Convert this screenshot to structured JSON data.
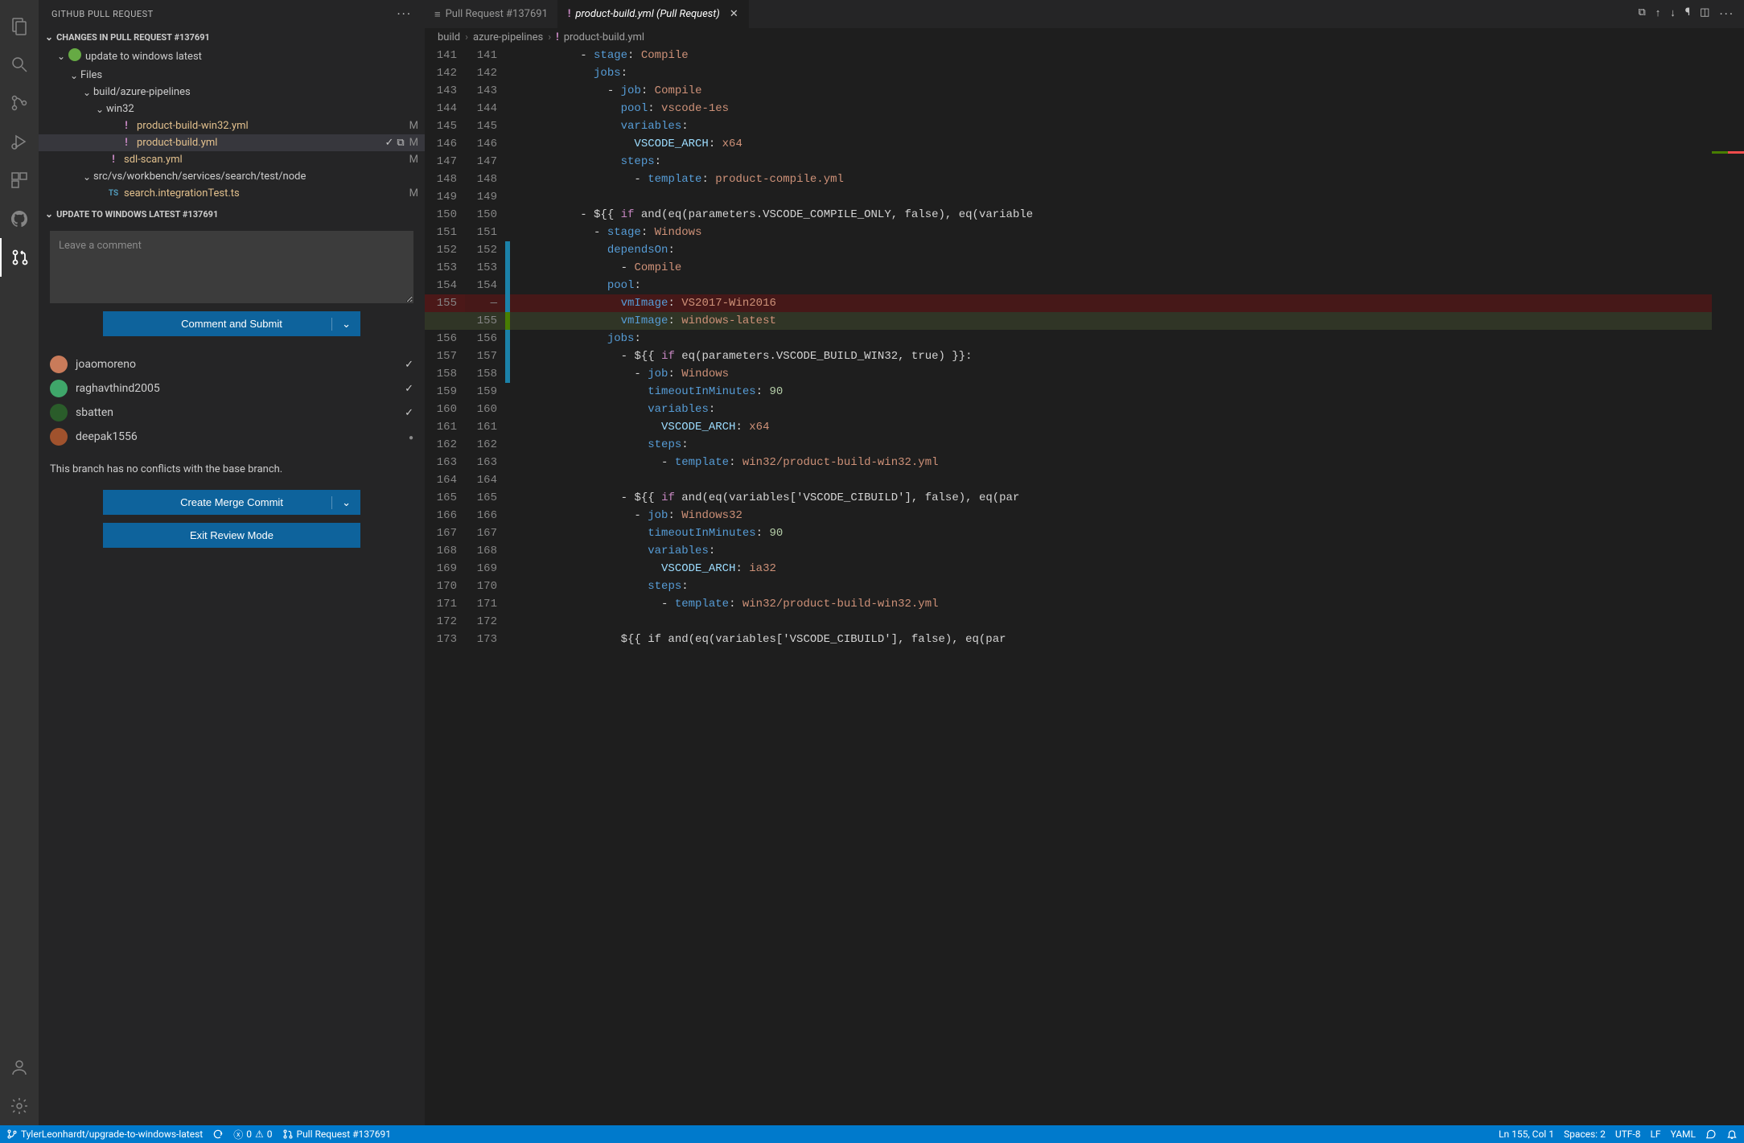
{
  "sidebar": {
    "title": "GITHUB PULL REQUEST",
    "section_changes": "CHANGES IN PULL REQUEST #137691",
    "commit_label": "update to windows latest",
    "files_label": "Files",
    "folders": {
      "build": "build/azure-pipelines",
      "win32": "win32",
      "src": "src/vs/workbench/services/search/test/node"
    },
    "files": [
      {
        "name": "product-build-win32.yml",
        "status": "M",
        "icon": "yml"
      },
      {
        "name": "product-build.yml",
        "status": "M",
        "icon": "yml",
        "selected": true
      },
      {
        "name": "sdl-scan.yml",
        "status": "M",
        "icon": "yml"
      },
      {
        "name": "search.integrationTest.ts",
        "status": "M",
        "icon": "ts"
      }
    ],
    "section_detail": "UPDATE TO WINDOWS LATEST #137691",
    "comment_placeholder": "Leave a comment",
    "btn_comment": "Comment and Submit",
    "reviewers": [
      {
        "name": "joaomoreno",
        "status": "check",
        "color": "#c97b5a"
      },
      {
        "name": "raghavthind2005",
        "status": "check",
        "color": "#3fa66a"
      },
      {
        "name": "sbatten",
        "status": "check",
        "color": "#2a5c2a"
      },
      {
        "name": "deepak1556",
        "status": "dot",
        "color": "#a0522d"
      }
    ],
    "conflict_note": "This branch has no conflicts with the base branch.",
    "btn_merge": "Create Merge Commit",
    "btn_exit": "Exit Review Mode"
  },
  "tabs": [
    {
      "label": "Pull Request #137691",
      "icon": "list",
      "active": false
    },
    {
      "label": "product-build.yml (Pull Request)",
      "icon": "yml",
      "active": true,
      "italic": true
    }
  ],
  "breadcrumbs": [
    "build",
    "azure-pipelines",
    "product-build.yml"
  ],
  "code_lines": [
    {
      "l": 141,
      "r": 141,
      "mark": "",
      "html": "        <span class='tok-dash'>-</span> <span class='tok-key'>stage</span><span class='tok-punc'>:</span> <span class='tok-str'>Compile</span>"
    },
    {
      "l": 142,
      "r": 142,
      "mark": "",
      "html": "          <span class='tok-key'>jobs</span><span class='tok-punc'>:</span>"
    },
    {
      "l": 143,
      "r": 143,
      "mark": "",
      "html": "            <span class='tok-dash'>-</span> <span class='tok-key'>job</span><span class='tok-punc'>:</span> <span class='tok-str'>Compile</span>"
    },
    {
      "l": 144,
      "r": 144,
      "mark": "",
      "html": "              <span class='tok-key'>pool</span><span class='tok-punc'>:</span> <span class='tok-str'>vscode-1es</span>"
    },
    {
      "l": 145,
      "r": 145,
      "mark": "",
      "html": "              <span class='tok-key'>variables</span><span class='tok-punc'>:</span>"
    },
    {
      "l": 146,
      "r": 146,
      "mark": "",
      "html": "                <span class='tok-var'>VSCODE_ARCH</span><span class='tok-punc'>:</span> <span class='tok-str'>x64</span>"
    },
    {
      "l": 147,
      "r": 147,
      "mark": "",
      "html": "              <span class='tok-key'>steps</span><span class='tok-punc'>:</span>"
    },
    {
      "l": 148,
      "r": 148,
      "mark": "",
      "html": "                <span class='tok-dash'>-</span> <span class='tok-key'>template</span><span class='tok-punc'>:</span> <span class='tok-str'>product-compile.yml</span>"
    },
    {
      "l": 149,
      "r": 149,
      "mark": "",
      "html": ""
    },
    {
      "l": 150,
      "r": 150,
      "mark": "",
      "html": "        <span class='tok-dash'>-</span> <span class='tok-expr'>${{</span> <span class='tok-kw'>if</span> <span class='tok-expr'>and(eq(parameters.VSCODE_COMPILE_ONLY, false), eq(variable</span>"
    },
    {
      "l": 151,
      "r": 151,
      "mark": "",
      "html": "          <span class='tok-dash'>-</span> <span class='tok-key'>stage</span><span class='tok-punc'>:</span> <span class='tok-str'>Windows</span>"
    },
    {
      "l": 152,
      "r": 152,
      "mark": "changed",
      "html": "            <span class='tok-key'>dependsOn</span><span class='tok-punc'>:</span>"
    },
    {
      "l": 153,
      "r": 153,
      "mark": "changed",
      "html": "              <span class='tok-dash'>-</span> <span class='tok-str'>Compile</span>"
    },
    {
      "l": 154,
      "r": 154,
      "mark": "changed",
      "html": "            <span class='tok-key'>pool</span><span class='tok-punc'>:</span>"
    },
    {
      "l": 155,
      "r": "",
      "mark": "changed",
      "removed": true,
      "html": "              <span class='tok-key'>vmImage</span><span class='tok-punc'>:</span> <span class='tok-str'>VS2017-Win2016</span>"
    },
    {
      "l": "",
      "r": 155,
      "mark": "added",
      "added": true,
      "html": "              <span class='tok-key'>vmImage</span><span class='tok-punc'>:</span> <span class='tok-str'>windows-latest</span>"
    },
    {
      "l": 156,
      "r": 156,
      "mark": "changed",
      "html": "            <span class='tok-key'>jobs</span><span class='tok-punc'>:</span>"
    },
    {
      "l": 157,
      "r": 157,
      "mark": "changed",
      "html": "              <span class='tok-dash'>-</span> <span class='tok-expr'>${{</span> <span class='tok-kw'>if</span> <span class='tok-expr'>eq(parameters.VSCODE_BUILD_WIN32, true) }}</span><span class='tok-punc'>:</span>"
    },
    {
      "l": 158,
      "r": 158,
      "mark": "changed",
      "html": "                <span class='tok-dash'>-</span> <span class='tok-key'>job</span><span class='tok-punc'>:</span> <span class='tok-str'>Windows</span>"
    },
    {
      "l": 159,
      "r": 159,
      "mark": "",
      "html": "                  <span class='tok-key'>timeoutInMinutes</span><span class='tok-punc'>:</span> <span class='tok-num'>90</span>"
    },
    {
      "l": 160,
      "r": 160,
      "mark": "",
      "html": "                  <span class='tok-key'>variables</span><span class='tok-punc'>:</span>"
    },
    {
      "l": 161,
      "r": 161,
      "mark": "",
      "html": "                    <span class='tok-var'>VSCODE_ARCH</span><span class='tok-punc'>:</span> <span class='tok-str'>x64</span>"
    },
    {
      "l": 162,
      "r": 162,
      "mark": "",
      "html": "                  <span class='tok-key'>steps</span><span class='tok-punc'>:</span>"
    },
    {
      "l": 163,
      "r": 163,
      "mark": "",
      "html": "                    <span class='tok-dash'>-</span> <span class='tok-key'>template</span><span class='tok-punc'>:</span> <span class='tok-str'>win32/product-build-win32.yml</span>"
    },
    {
      "l": 164,
      "r": 164,
      "mark": "",
      "html": ""
    },
    {
      "l": 165,
      "r": 165,
      "mark": "",
      "html": "              <span class='tok-dash'>-</span> <span class='tok-expr'>${{</span> <span class='tok-kw'>if</span> <span class='tok-expr'>and(eq(variables['VSCODE_CIBUILD'], false), eq(par</span>"
    },
    {
      "l": 166,
      "r": 166,
      "mark": "",
      "html": "                <span class='tok-dash'>-</span> <span class='tok-key'>job</span><span class='tok-punc'>:</span> <span class='tok-str'>Windows32</span>"
    },
    {
      "l": 167,
      "r": 167,
      "mark": "",
      "html": "                  <span class='tok-key'>timeoutInMinutes</span><span class='tok-punc'>:</span> <span class='tok-num'>90</span>"
    },
    {
      "l": 168,
      "r": 168,
      "mark": "",
      "html": "                  <span class='tok-key'>variables</span><span class='tok-punc'>:</span>"
    },
    {
      "l": 169,
      "r": 169,
      "mark": "",
      "html": "                    <span class='tok-var'>VSCODE_ARCH</span><span class='tok-punc'>:</span> <span class='tok-str'>ia32</span>"
    },
    {
      "l": 170,
      "r": 170,
      "mark": "",
      "html": "                  <span class='tok-key'>steps</span><span class='tok-punc'>:</span>"
    },
    {
      "l": 171,
      "r": 171,
      "mark": "",
      "html": "                    <span class='tok-dash'>-</span> <span class='tok-key'>template</span><span class='tok-punc'>:</span> <span class='tok-str'>win32/product-build-win32.yml</span>"
    },
    {
      "l": 172,
      "r": 172,
      "mark": "",
      "html": ""
    },
    {
      "l": 173,
      "r": 173,
      "mark": "",
      "html": "              <span class='tok-expr'>${{ if and(eq(variables['VSCODE_CIBUILD'], false), eq(par</span>"
    }
  ],
  "statusbar": {
    "branch": "TylerLeonhardt/upgrade-to-windows-latest",
    "errors": "0",
    "warnings": "0",
    "pr": "Pull Request #137691",
    "ln_col": "Ln 155, Col 1",
    "spaces": "Spaces: 2",
    "encoding": "UTF-8",
    "eol": "LF",
    "lang": "YAML"
  }
}
